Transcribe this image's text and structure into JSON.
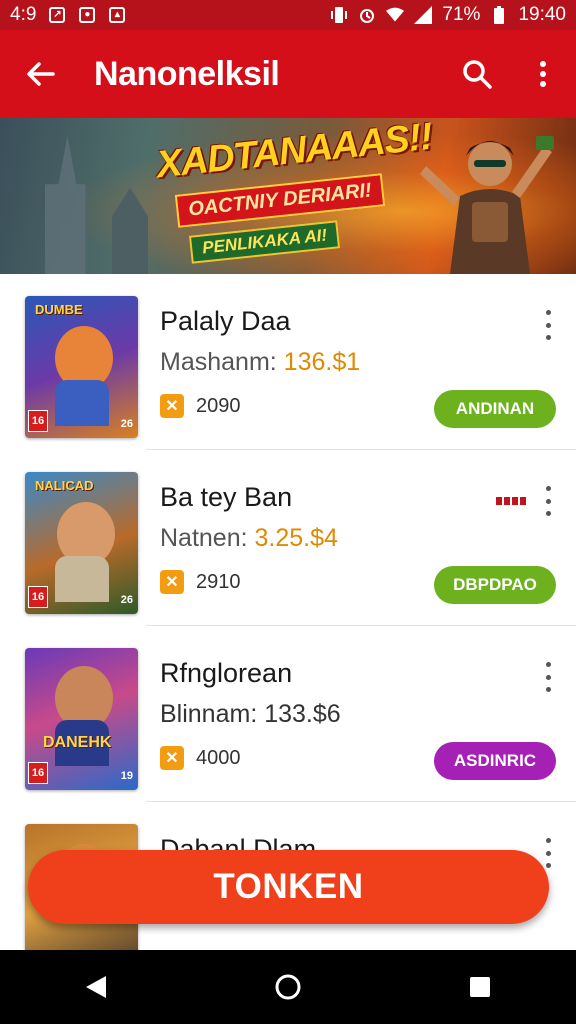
{
  "status": {
    "time_left": "4:9",
    "battery_percent": "71%",
    "time": "19:40"
  },
  "appbar": {
    "title": "Nanonelksil"
  },
  "banner": {
    "headline": "XADTANAAAS!!",
    "subline": "OACTNIY DERIARI!",
    "tag": "PENLIKAKA AI!"
  },
  "games": [
    {
      "name": "Palaly Daa",
      "meta_label": "Mashanm:",
      "meta_value": "136.$1",
      "points": "2090",
      "button_label": "ANDINAN",
      "button_color": "#6db21e",
      "thumb_label": "DUMBE",
      "thumb_rating": "16",
      "thumb_corner": "26"
    },
    {
      "name": "Ba tey Ban",
      "meta_label": "Natnen:",
      "meta_value": "3.25.$4",
      "points": "2910",
      "button_label": "DBPDPAO",
      "button_color": "#6db21e",
      "thumb_label": "NALICAD",
      "thumb_rating": "16",
      "thumb_corner": "26"
    },
    {
      "name": "Rfnglorean",
      "meta_label": "Blinnam:",
      "meta_value": "133.$6",
      "points": "4000",
      "button_label": "ASDINRIC",
      "button_color": "#a521b5",
      "thumb_label": "DANEHK",
      "thumb_rating": "16",
      "thumb_corner": "19"
    },
    {
      "name": "Dabanl Dlam",
      "meta_label": "",
      "meta_value": "",
      "points": "",
      "button_label": "",
      "button_color": "#6db21e",
      "thumb_label": "",
      "thumb_rating": "",
      "thumb_corner": ""
    }
  ],
  "fab": {
    "label": "TONKEN"
  },
  "colors": {
    "app_red": "#d50f1a",
    "status_red": "#b5121b",
    "fab_orange": "#f0401b",
    "price_orange": "#e08a00"
  },
  "icons": [
    "back-arrow-icon",
    "search-icon",
    "more-vert-icon",
    "coin-icon",
    "nav-back-icon",
    "nav-home-icon",
    "nav-recents-icon"
  ]
}
